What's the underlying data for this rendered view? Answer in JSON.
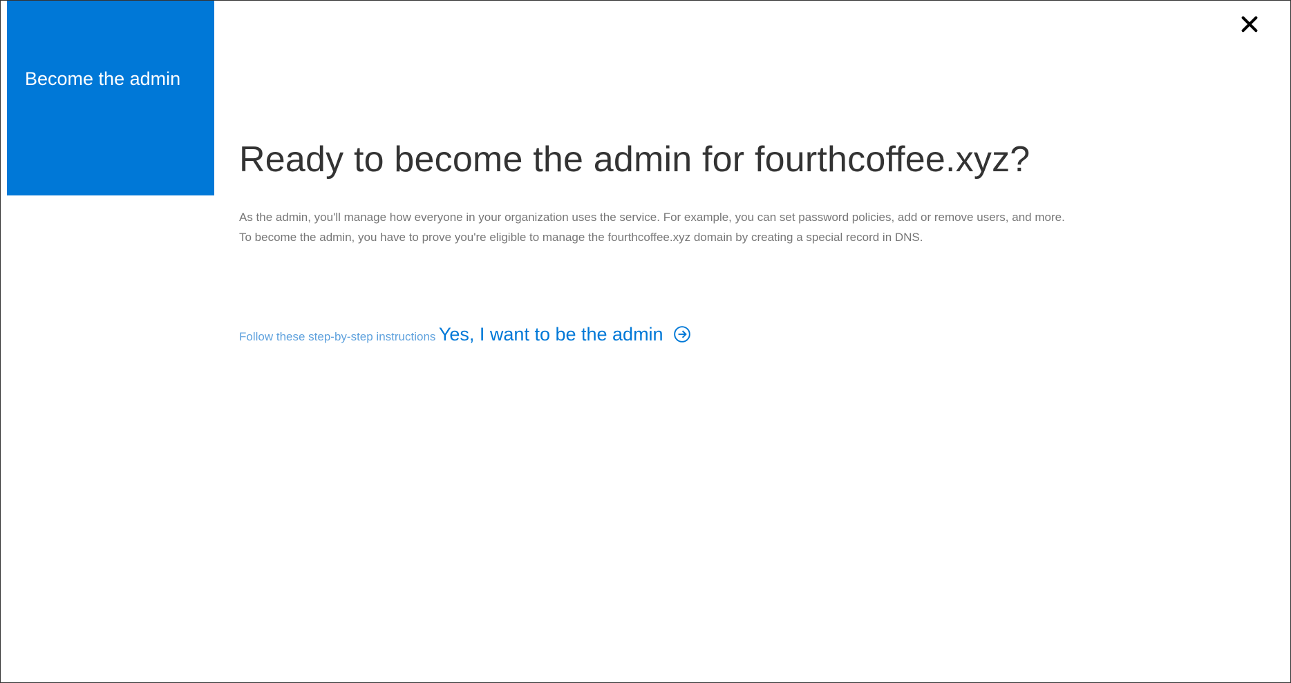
{
  "sidebar": {
    "title": "Become the admin"
  },
  "main": {
    "heading": "Ready to become the admin for fourthcoffee.xyz?",
    "paragraph1": "As the admin, you'll manage how everyone in your organization uses the service. For example, you can set password policies, add or remove users, and more.",
    "paragraph2": "To become the admin, you have to prove you're eligible to manage the fourthcoffee.xyz domain by creating a special record in DNS.",
    "instructions_link": "Follow these step-by-step instructions",
    "cta_label": "Yes, I want to be the admin"
  }
}
